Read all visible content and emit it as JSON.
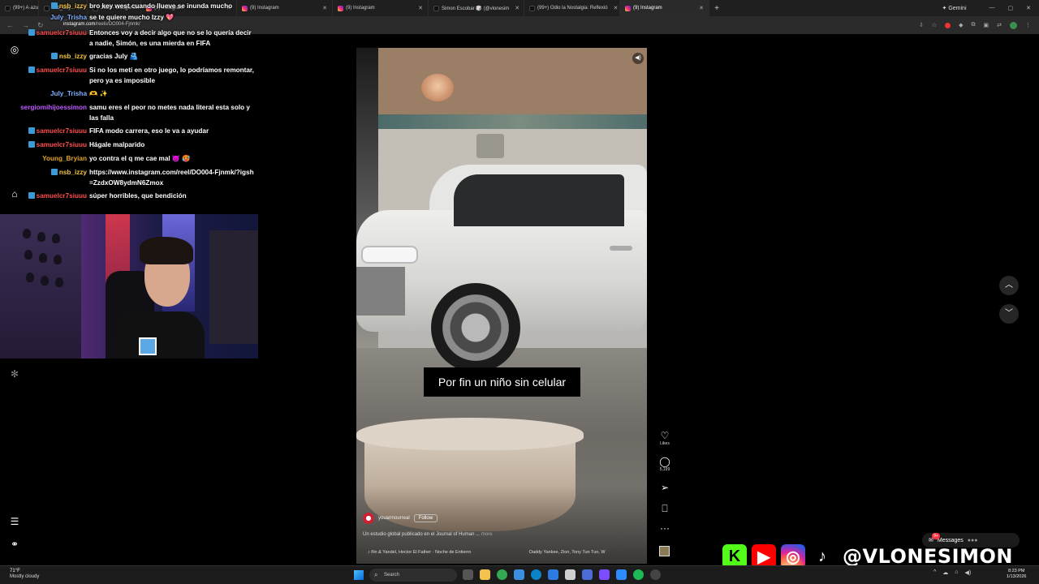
{
  "browser": {
    "tabs": [
      {
        "title": "(99+) A·azu",
        "icon": "tiktok-icon"
      },
      {
        "title": "nsb_izzy",
        "icon": "tiktok-icon"
      },
      {
        "title": "2026 - Google Sh",
        "icon": "google-icon"
      },
      {
        "title": "(9) Instagram",
        "icon": "instagram-icon"
      },
      {
        "title": "(9) Instagram",
        "icon": "instagram-icon"
      },
      {
        "title": "(9) Instagram",
        "icon": "instagram-icon"
      },
      {
        "title": "Simon Escobar 🎲 (@vlonesim",
        "icon": "tiktok-icon"
      },
      {
        "title": "(99+) Odio la Nostalgia: Reflexió",
        "icon": "tiktok-icon"
      },
      {
        "title": "(9) Instagram",
        "icon": "instagram-icon"
      }
    ],
    "gemini_label": "✦ Gemini",
    "url_host": "instagram.com",
    "url_path": "/reels/DO004-Fjnmk/"
  },
  "chat": {
    "messages": [
      {
        "user": "nsb_izzy",
        "color": "#f4c542",
        "badge": true,
        "text": "bro key west cuando llueve se inunda mucho"
      },
      {
        "user": "July_Trisha",
        "color": "#7fb0ff",
        "badge": false,
        "text": "se te quiere mucho Izzy 💖"
      },
      {
        "user": "samuelcr7siuuu",
        "color": "#ff4f4f",
        "badge": true,
        "text": "Entonces voy a decir algo que no se lo quería decir a nadie, Simón, es una mierda en FIFA"
      },
      {
        "user": "nsb_izzy",
        "color": "#f4c542",
        "badge": true,
        "text": "gracias July 🫂"
      },
      {
        "user": "samuelcr7siuuu",
        "color": "#ff4f4f",
        "badge": true,
        "text": "Si no los metí en otro juego, lo podríamos remontar, pero ya es imposible"
      },
      {
        "user": "July_Trisha",
        "color": "#7fb0ff",
        "badge": false,
        "text": "🫶 ✨"
      },
      {
        "user": "sergiomihijoessimon",
        "color": "#c05cff",
        "badge": false,
        "text": "samu eres el peor no metes nada literal esta solo y las falla"
      },
      {
        "user": "samuelcr7siuuu",
        "color": "#ff4f4f",
        "badge": true,
        "text": "FIFA modo carrera, eso le va a ayudar"
      },
      {
        "user": "samuelcr7siuuu",
        "color": "#ff4f4f",
        "badge": true,
        "text": "Hágale malparido"
      },
      {
        "user": "Young_Bryian",
        "color": "#e0a32e",
        "badge": false,
        "text": "yo contra el q me cae mal 😈 🥵"
      },
      {
        "user": "nsb_izzy",
        "color": "#f4c542",
        "badge": true,
        "text": "https://www.instagram.com/reel/DO004-Fjnmk/?igsh=ZzdxOW8ydmN6Zmox"
      },
      {
        "user": "samuelcr7siuuu",
        "color": "#ff4f4f",
        "badge": true,
        "text": "súper horribles, que bendición"
      }
    ]
  },
  "video": {
    "subtitle": "Por fin un niño sin celular",
    "account": "youarmourreal",
    "follow_label": "Follow",
    "description": "Un estudio global publicado en el Journal of Human ...",
    "more_label": "more",
    "music_left": "♪ ñin & Yandel, Hector El Father · Noche de Entierro",
    "music_right": "Daddy Yankee, Zion, Tony Tun Tun, W",
    "likes_label": "Likes",
    "comments_count": "5,199"
  },
  "overlay": {
    "handle": "@VLONESIMON",
    "messages_label": "Messages",
    "messages_badge": "9+"
  },
  "taskbar": {
    "temp": "71°F",
    "weather": "Mostly cloudy",
    "search_placeholder": "Search",
    "time": "8:23 PM",
    "date": "1/13/2026"
  }
}
